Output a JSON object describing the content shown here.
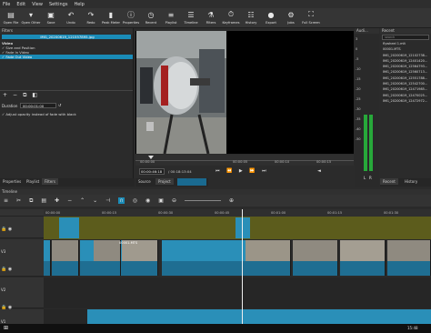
{
  "menu": [
    "File",
    "Edit",
    "View",
    "Settings",
    "Help"
  ],
  "toolbar": [
    {
      "label": "Open File",
      "icon": "open-file-icon",
      "glyph": "▤"
    },
    {
      "label": "Open Other",
      "icon": "open-other-icon",
      "glyph": "▾"
    },
    {
      "label": "Save",
      "icon": "save-icon",
      "glyph": "▣"
    },
    {
      "label": "Undo",
      "icon": "undo-icon",
      "glyph": "↶"
    },
    {
      "label": "Redo",
      "icon": "redo-icon",
      "glyph": "↷"
    },
    {
      "label": "Peak Meter",
      "icon": "peak-meter-icon",
      "glyph": "▮"
    },
    {
      "label": "Properties",
      "icon": "properties-icon",
      "glyph": "ⓘ"
    },
    {
      "label": "Recent",
      "icon": "recent-icon",
      "glyph": "◷"
    },
    {
      "label": "Playlist",
      "icon": "playlist-icon",
      "glyph": "≡"
    },
    {
      "label": "Timeline",
      "icon": "timeline-icon",
      "glyph": "☰"
    },
    {
      "label": "Filters",
      "icon": "filters-icon",
      "glyph": "⚗"
    },
    {
      "label": "Keyframes",
      "icon": "keyframes-icon",
      "glyph": "⏱"
    },
    {
      "label": "History",
      "icon": "history-icon",
      "glyph": "☷"
    },
    {
      "label": "Export",
      "icon": "export-icon",
      "glyph": "●"
    },
    {
      "label": "Jobs",
      "icon": "jobs-icon",
      "glyph": "⚙"
    },
    {
      "label": "Full Screen",
      "icon": "full-screen-icon",
      "glyph": "⛶"
    }
  ],
  "filters": {
    "title": "Filters",
    "clip_name": "IMG_20200619_121557895.jpg",
    "section": "Video",
    "items": [
      "Size and Position",
      "Fade In Video",
      "Fade Out Video"
    ],
    "duration_label": "Duration",
    "duration_value": "00:00:01:00",
    "adjust_label": "Adjust opacity instead of fade with black"
  },
  "left_tabs": [
    "Properties",
    "Playlist",
    "Filters"
  ],
  "player": {
    "ruler": [
      "00:00:00",
      "00:00:05",
      "00:00:10",
      "00:00:15",
      "00:00:20"
    ],
    "timecode": "00:00:46:18",
    "duration": "/ 00:18:13:04",
    "tabs": [
      "Source",
      "Project"
    ]
  },
  "audio": {
    "title": "Audi...",
    "scale": [
      "3",
      "0",
      "-5",
      "-10",
      "-15",
      "-20",
      "-25",
      "-30",
      "-35",
      "-40",
      "-50"
    ],
    "channels": [
      "L",
      "R"
    ],
    "level": 0.38
  },
  "recent": {
    "title": "Recent",
    "search": "search",
    "items": [
      "flywheel 1.mlt",
      "00001.MTS",
      "IMG_20200619_12102738...",
      "IMG_20200619_12401420...",
      "IMG_20200619_12564793...",
      "IMG_20200619_12560713...",
      "IMG_20200619_12551788...",
      "IMG_20200619_12542700...",
      "IMG_20200619_12471985...",
      "IMG_20200619_12470025...",
      "IMG_20200619_12472972..."
    ],
    "tabs": [
      "Recent",
      "History"
    ]
  },
  "timeline": {
    "title": "Timeline",
    "ruler": [
      "00:00:00",
      "00:00:15",
      "00:00:30",
      "00:00:45",
      "00:01:00",
      "00:01:15",
      "00:01:30"
    ],
    "tracks": [
      "Output",
      "V3",
      "V2",
      "V1",
      "A1"
    ],
    "clip_label": "00001.MTS"
  },
  "clock": "15:48",
  "colors": {
    "accent": "#1a8cb8",
    "clip": "#2a8fb8",
    "audio": "#6a6a1e",
    "meter": "#27a83a"
  }
}
